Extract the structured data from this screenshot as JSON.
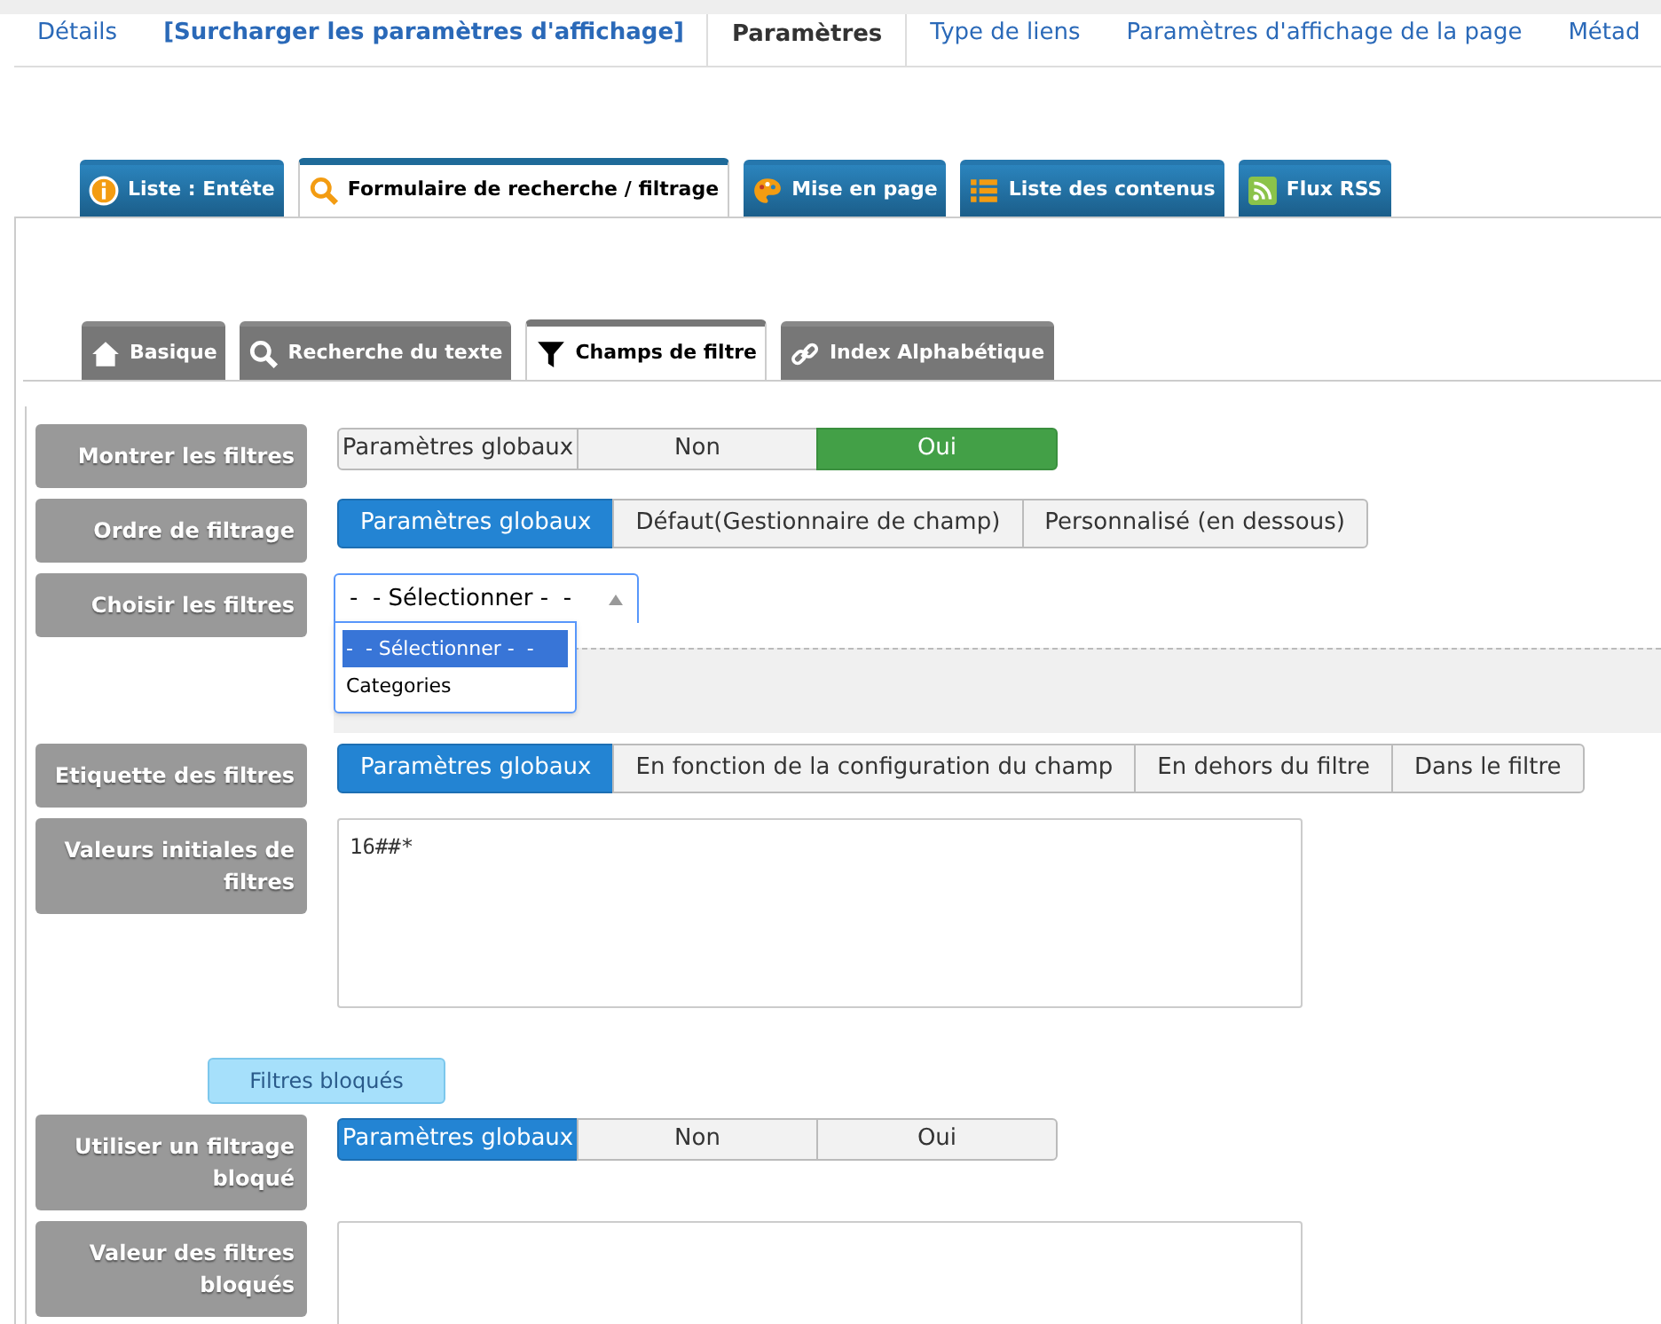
{
  "top_tabs": [
    {
      "label": "Détails",
      "selected": false,
      "bold": false
    },
    {
      "label": "[Surcharger les paramètres d'affichage]",
      "selected": false,
      "bold": true
    },
    {
      "label": "Paramètres",
      "selected": true,
      "bold": false
    },
    {
      "label": "Type de liens",
      "selected": false,
      "bold": false
    },
    {
      "label": "Paramètres d'affichage de la page",
      "selected": false,
      "bold": false
    },
    {
      "label": "Métad",
      "selected": false,
      "bold": false
    }
  ],
  "section_tabs": [
    {
      "label": "Liste : Entête",
      "selected": false
    },
    {
      "label": "Formulaire de recherche / filtrage",
      "selected": true
    },
    {
      "label": "Mise en page",
      "selected": false
    },
    {
      "label": "Liste des contenus",
      "selected": false
    },
    {
      "label": "Flux RSS",
      "selected": false
    }
  ],
  "sub_tabs": [
    {
      "label": "Basique",
      "selected": false
    },
    {
      "label": "Recherche du texte",
      "selected": false
    },
    {
      "label": "Champs de filtre",
      "selected": true
    },
    {
      "label": "Index Alphabétique",
      "selected": false
    }
  ],
  "rows": [
    {
      "kind": "toggle",
      "label": "Montrer les filtres",
      "options": [
        {
          "label": "Paramètres globaux",
          "kind": "global",
          "selected": false
        },
        {
          "label": "Non",
          "kind": "no",
          "selected": false
        },
        {
          "label": "Oui",
          "kind": "yes",
          "selected": true
        }
      ]
    },
    {
      "kind": "buttons",
      "label": "Ordre de filtrage",
      "options": [
        {
          "label": "Paramètres globaux",
          "kind": "global",
          "selected": true
        },
        {
          "label": "Défaut(Gestionnaire de champ)",
          "kind": "plain",
          "selected": false
        },
        {
          "label": "Personnalisé (en dessous)",
          "kind": "plain",
          "selected": false
        }
      ]
    },
    {
      "kind": "select",
      "label": "Choisir les filtres",
      "value": "-  - Sélectionner -  -",
      "options": [
        {
          "label": "-  - Sélectionner -  -",
          "selected": true
        },
        {
          "label": "Categories",
          "selected": false
        }
      ]
    },
    {
      "kind": "buttons",
      "label": "Etiquette des filtres",
      "options": [
        {
          "label": "Paramètres globaux",
          "kind": "global",
          "selected": true
        },
        {
          "label": "En fonction de la configuration du champ",
          "kind": "plain",
          "selected": false
        },
        {
          "label": "En dehors du filtre",
          "kind": "plain",
          "selected": false
        },
        {
          "label": "Dans le filtre",
          "kind": "plain",
          "selected": false
        }
      ]
    },
    {
      "kind": "textarea",
      "label": "Valeurs initiales de filtres",
      "value": "16##*"
    },
    {
      "kind": "heading",
      "label": "Filtres bloqués"
    },
    {
      "kind": "toggle",
      "label": "Utiliser un filtrage bloqué",
      "options": [
        {
          "label": "Paramètres globaux",
          "kind": "global",
          "selected": true
        },
        {
          "label": "Non",
          "kind": "no",
          "selected": false
        },
        {
          "label": "Oui",
          "kind": "yes",
          "selected": false
        }
      ]
    },
    {
      "kind": "textarea",
      "label": "Valeur des filtres bloqués",
      "value": ""
    }
  ]
}
